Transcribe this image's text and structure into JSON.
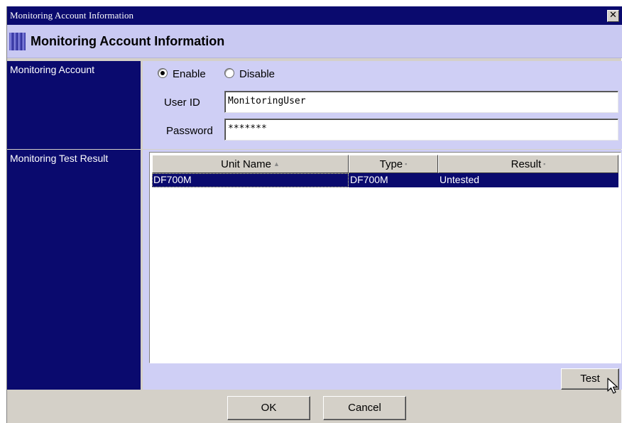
{
  "window": {
    "title": "Monitoring Account Information",
    "close_glyph": "✕"
  },
  "header": {
    "title": "Monitoring Account Information"
  },
  "account": {
    "label": "Monitoring Account",
    "enable_label": "Enable",
    "disable_label": "Disable",
    "selected": "Enable",
    "userid_label": "User ID",
    "userid_value": "MonitoringUser",
    "password_label": "Password",
    "password_value": "*******"
  },
  "test_result": {
    "label": "Monitoring Test Result",
    "columns": [
      "Unit Name",
      "Type",
      "Result"
    ],
    "sort_indicators": [
      "▲",
      "▪",
      "▪"
    ],
    "rows": [
      {
        "unit_name": "DF700M",
        "type": "DF700M",
        "result": "Untested"
      }
    ]
  },
  "buttons": {
    "test": "Test",
    "ok": "OK",
    "cancel": "Cancel"
  },
  "colors": {
    "titlebar": "#0a0a6e",
    "panel": "#cfcff5",
    "header": "#c9c9f2",
    "dialog": "#d4d0c8"
  },
  "icons": {
    "close": "close-icon",
    "header_mark": "header-mark-icon",
    "cursor": "mouse-pointer-icon"
  }
}
